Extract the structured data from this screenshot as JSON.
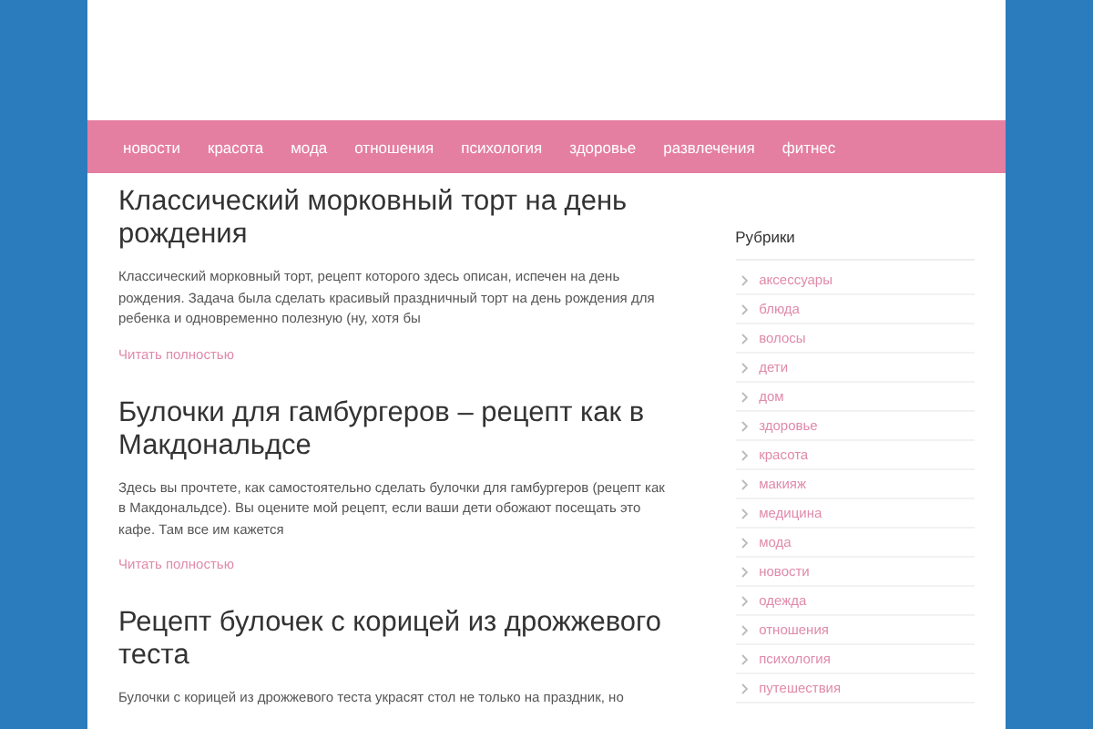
{
  "nav": [
    "новости",
    "красота",
    "мода",
    "отношения",
    "психология",
    "здоровье",
    "развлечения",
    "фитнес"
  ],
  "posts": [
    {
      "title": "Классический морковный торт на день рождения",
      "excerpt": "Классический морковный торт, рецепт которого здесь описан, испечен на день рождения. Задача была сделать красивый праздничный торт на день рождения для ребенка и одновременно полезную (ну, хотя бы",
      "more": "Читать полностью"
    },
    {
      "title": "Булочки для гамбургеров – рецепт как в Макдональдсе",
      "excerpt": "Здесь вы прочтете, как самостоятельно сделать булочки для гамбургеров (рецепт как в Макдональдсе). Вы оцените мой рецепт, если ваши дети обожают посещать это кафе. Там все им кажется",
      "more": "Читать полностью"
    },
    {
      "title": "Рецепт булочек с корицей из дрожжевого теста",
      "excerpt": "Булочки с корицей из дрожжевого теста украсят стол не только на праздник, но"
    }
  ],
  "sidebar": {
    "title": "Рубрики",
    "items": [
      "аксессуары",
      "блюда",
      "волосы",
      "дети",
      "дом",
      "здоровье",
      "красота",
      "макияж",
      "медицина",
      "мода",
      "новости",
      "одежда",
      "отношения",
      "психология",
      "путешествия"
    ]
  }
}
